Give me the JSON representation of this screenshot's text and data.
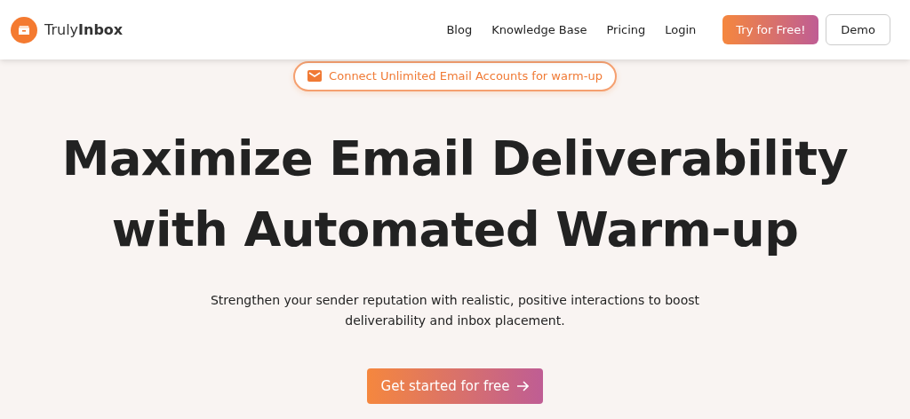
{
  "header": {
    "brand": "Truly",
    "brand_bold": "Inbox",
    "nav": [
      "Blog",
      "Knowledge Base",
      "Pricing",
      "Login"
    ],
    "primary_button": "Try for Free!",
    "secondary_button": "Demo"
  },
  "hero": {
    "badge": "Connect Unlimited Email Accounts for warm-up",
    "title_lines": [
      "Maximize Email Deliverability",
      "with Automated Warm-up"
    ],
    "subtitle_lines": [
      "Strengthen your sender reputation with realistic, positive interactions to boost",
      "deliverability and inbox placement."
    ],
    "cta": "Get started for free"
  }
}
